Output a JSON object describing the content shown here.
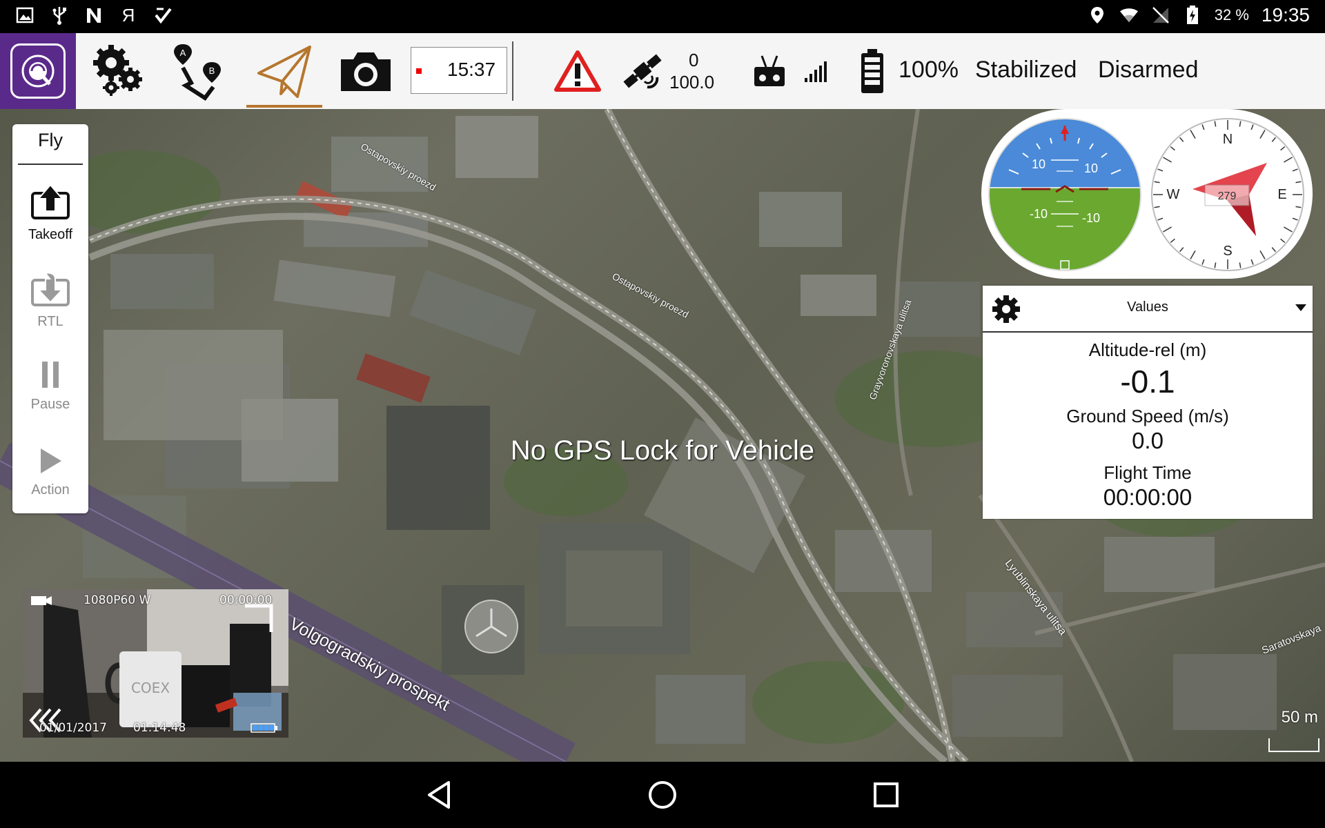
{
  "status_bar": {
    "left_icons": [
      "image-icon",
      "usb-icon",
      "n-icon",
      "yandex-icon",
      "checkmark-icon"
    ],
    "yandex_glyph": "Я",
    "battery_percent": "32 %",
    "time": "19:35"
  },
  "toolbar": {
    "timer": "15:37",
    "satellite_count": "0",
    "hdop": "100.0",
    "battery": "100%",
    "flight_mode": "Stabilized",
    "arm_state": "Disarmed"
  },
  "fly_panel": {
    "title": "Fly",
    "takeoff_label": "Takeoff",
    "rtl_label": "RTL",
    "pause_label": "Pause",
    "action_label": "Action"
  },
  "map": {
    "message": "No GPS Lock for Vehicle",
    "street_labels": [
      "Ostapovskiy proezd",
      "Ostapovskiy proezd",
      "Grayvoronovskaya ulitsa",
      "Volgogradskiy prospekt",
      "Lyublinskaya ulitsa",
      "Saratovskaya"
    ],
    "scale_label": "50 m"
  },
  "attitude": {
    "pitch_up_left": "10",
    "pitch_up_right": "10",
    "pitch_down_left": "-10",
    "pitch_down_right": "-10"
  },
  "compass": {
    "heading": "279",
    "north": "N",
    "south": "S",
    "east": "E",
    "west": "W"
  },
  "values_widget": {
    "title": "Values",
    "altitude_label": "Altitude-rel (m)",
    "altitude_value": "-0.1",
    "ground_speed_label": "Ground Speed (m/s)",
    "ground_speed_value": "0.0",
    "flight_time_label": "Flight Time",
    "flight_time_value": "00:00:00"
  },
  "camera": {
    "resolution": "1080P60 W",
    "rec_time": "00:00:00",
    "date": "01/01/2017",
    "time": "01:14:48",
    "mug_text": "COEX"
  },
  "colors": {
    "brand": "#5a2a8a",
    "plan_accent": "#b6762e",
    "sky": "#4a8ad8",
    "ground": "#6aa830",
    "compass_needle": "#e0303a"
  }
}
